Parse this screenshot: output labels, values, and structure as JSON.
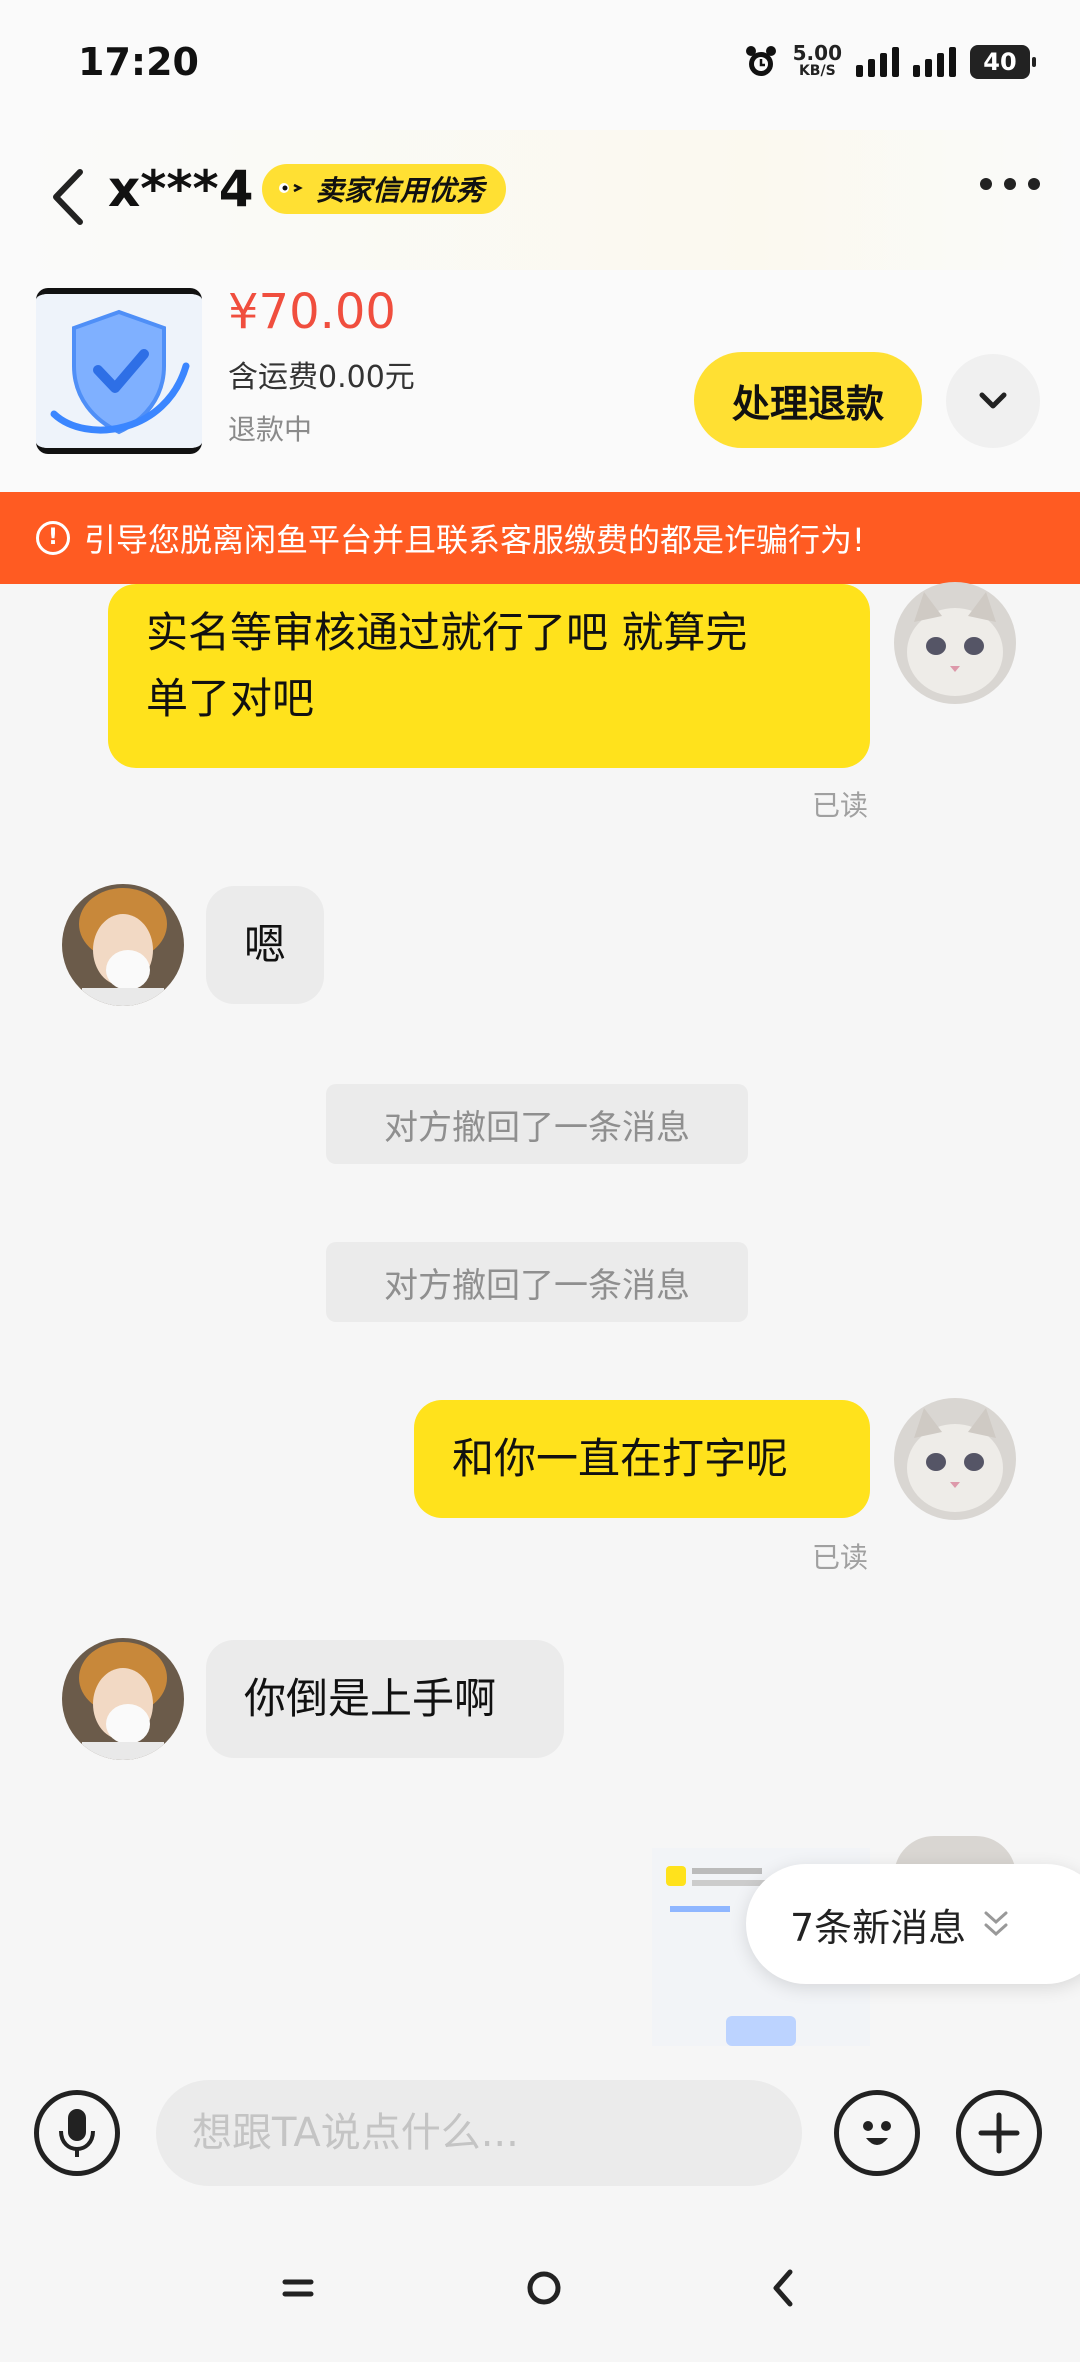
{
  "status_bar": {
    "time": "17:20",
    "speed_value": "5.00",
    "speed_unit": "KB/S",
    "battery": "40"
  },
  "header": {
    "title": "x***4",
    "badge_label": "卖家信用优秀"
  },
  "product": {
    "price": "¥70.00",
    "shipping": "含运费0.00元",
    "status": "退款中",
    "action_label": "处理退款"
  },
  "warning": {
    "icon_text": "!",
    "text": "引导您脱离闲鱼平台并且联系客服缴费的都是诈骗行为!"
  },
  "messages": {
    "m1": {
      "text_line1": "实名等审核通过就行了吧 就算完",
      "text_line2": "单了对吧",
      "read": "已读"
    },
    "m2": {
      "text": "嗯"
    },
    "sys1": {
      "text": "对方撤回了一条消息"
    },
    "sys2": {
      "text": "对方撤回了一条消息"
    },
    "m3": {
      "text": "和你一直在打字呢",
      "read": "已读"
    },
    "m4": {
      "text": "你倒是上手啊"
    }
  },
  "new_messages": {
    "label": "7条新消息"
  },
  "input": {
    "placeholder": "想跟TA说点什么..."
  },
  "icons": {
    "back": "chevron-left-icon",
    "more": "more-dots-icon",
    "expand": "chevron-down-icon",
    "voice": "microphone-icon",
    "emoji": "emoji-icon",
    "add": "plus-icon"
  },
  "colors": {
    "accent_yellow": "#ffe21c",
    "warning_orange": "#ff5b22",
    "price_red": "#f04e3e"
  }
}
